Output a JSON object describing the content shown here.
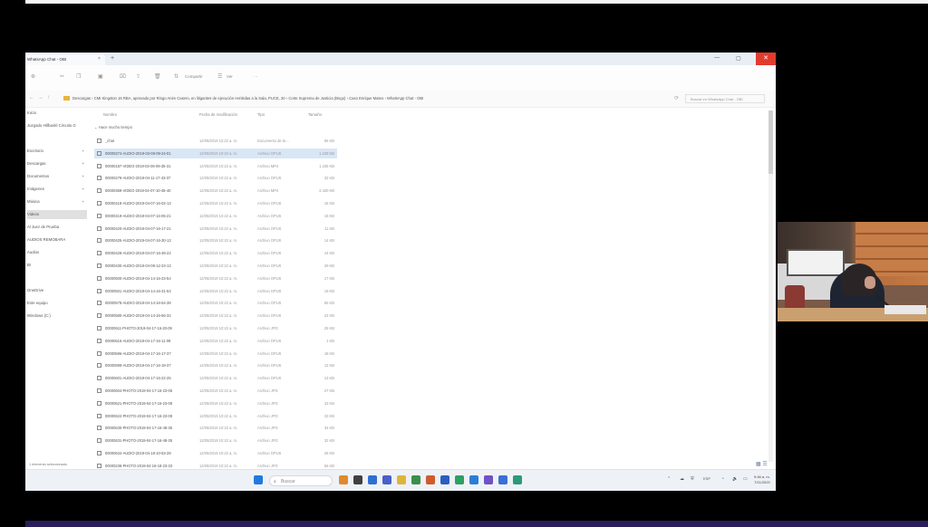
{
  "window": {
    "tab_title": "WhatsApp Chat - OBI",
    "tab_close": "×",
    "new_tab": "+",
    "controls": {
      "minimize": "—",
      "maximize": "▢",
      "close": "✕"
    }
  },
  "commandbar": {
    "share_label": "Compartir",
    "view_label": "Ver",
    "more": "···"
  },
  "address": {
    "back": "←",
    "forward": "→",
    "up": "↑",
    "refresh": "⟳",
    "path": "Descargas › CMI Kingston 16 RBA, aprovado por Ringo Anim Casero, en litigantes de ejecución remitidas a la Sala, PUCE, 20 › Corte Suprema de Justicia (Bogo) › Caso Enrique Mateo › WhatsApp Chat - OBI",
    "search_placeholder": "Buscar en WhatsApp Chat - OBI"
  },
  "sidebar": {
    "items": [
      {
        "label": "Inicio"
      },
      {
        "label": "Juzgado Hillbuskl Circuito G"
      },
      {
        "label": "Escritorio"
      },
      {
        "label": "Descargas"
      },
      {
        "label": "Documentos"
      },
      {
        "label": "Imágenes"
      },
      {
        "label": "Música"
      },
      {
        "label": "Videos"
      },
      {
        "label": "Al Juez de Prueba"
      },
      {
        "label": "AUDIOS REMOBARA"
      },
      {
        "label": "Audios"
      },
      {
        "label": "BI"
      },
      {
        "label": "OneDrive"
      },
      {
        "label": "Este equipo"
      },
      {
        "label": "Windows (C:)"
      }
    ]
  },
  "columns": {
    "name": "Nombre",
    "date": "Fecha de modificación",
    "type": "Tipo",
    "size": "Tamaño"
  },
  "group_label": "Hace mucho tiempo",
  "files": [
    {
      "name": "_chat",
      "date": "12/05/2019 10:22 a. m.",
      "type": "Documento de te...",
      "size": "56 KB"
    },
    {
      "name": "00000274-AUDIO-2019-03-08-09-24-01",
      "date": "12/05/2019 10:22 a. m.",
      "type": "Archivo OPUS",
      "size": "1.238 KB"
    },
    {
      "name": "00000187-VIDEO-2019-03-06-09-35-31",
      "date": "12/05/2019 10:22 a. m.",
      "type": "Archivo MP4",
      "size": "1.235 KB"
    },
    {
      "name": "00000279-AUDIO-2019-04-11-17-43-37",
      "date": "12/05/2019 10:22 a. m.",
      "type": "Archivo OPUS",
      "size": "32 KB"
    },
    {
      "name": "00000369-VIDEO-2019-04-07-10-48-40",
      "date": "12/05/2019 10:22 a. m.",
      "type": "Archivo MP4",
      "size": "2.420 KB"
    },
    {
      "name": "00000418-AUDIO-2019-04-07-16-02-13",
      "date": "12/05/2019 10:22 a. m.",
      "type": "Archivo OPUS",
      "size": "16 KB"
    },
    {
      "name": "00000419-AUDIO-2019-04-07-16-05-21",
      "date": "12/05/2019 10:22 a. m.",
      "type": "Archivo OPUS",
      "size": "15 KB"
    },
    {
      "name": "00000420-AUDIO-2019-04-07-16-17-21",
      "date": "12/05/2019 10:22 a. m.",
      "type": "Archivo OPUS",
      "size": "11 KB"
    },
    {
      "name": "00000425-AUDIO-2019-04-07-16-30-13",
      "date": "12/05/2019 10:22 a. m.",
      "type": "Archivo OPUS",
      "size": "14 KB"
    },
    {
      "name": "00000428-AUDIO-2019-04-07-16-48-22",
      "date": "12/05/2019 10:22 a. m.",
      "type": "Archivo OPUS",
      "size": "44 KB"
    },
    {
      "name": "00000430-AUDIO-2019-04-08-12-23-13",
      "date": "12/05/2019 10:22 a. m.",
      "type": "Archivo OPUS",
      "size": "29 KB"
    },
    {
      "name": "00000500-AUDIO-2019-04-14-16-23-54",
      "date": "12/05/2019 10:22 a. m.",
      "type": "Archivo OPUS",
      "size": "17 KB"
    },
    {
      "name": "00000501-AUDIO-2019-04-14-16-31-53",
      "date": "12/05/2019 10:22 a. m.",
      "type": "Archivo OPUS",
      "size": "19 KB"
    },
    {
      "name": "00000578-AUDIO-2019-04-14-16-54-38",
      "date": "12/05/2019 10:22 a. m.",
      "type": "Archivo OPUS",
      "size": "65 KB"
    },
    {
      "name": "00000580-AUDIO-2019-04-14-16-56-32",
      "date": "12/05/2019 10:22 a. m.",
      "type": "Archivo OPUS",
      "size": "22 KB"
    },
    {
      "name": "00000611-PHOTO-2019-04-17-16-20-09",
      "date": "12/05/2019 10:22 a. m.",
      "type": "Archivo JPG",
      "size": "25 KB"
    },
    {
      "name": "00000616-AUDIO-2019-04-17-16-11-08",
      "date": "12/05/2019 10:22 a. m.",
      "type": "Archivo OPUS",
      "size": "1 KB"
    },
    {
      "name": "00000596-AUDIO-2019-04-17-16-17-37",
      "date": "12/05/2019 10:22 a. m.",
      "type": "Archivo OPUS",
      "size": "18 KB"
    },
    {
      "name": "00000599-AUDIO-2019-04-17-16-18-37",
      "date": "12/05/2019 10:22 a. m.",
      "type": "Archivo OPUS",
      "size": "12 KB"
    },
    {
      "name": "00000601-AUDIO-2019-04-17-16-22-25",
      "date": "12/05/2019 10:22 a. m.",
      "type": "Archivo OPUS",
      "size": "13 KB"
    },
    {
      "name": "00000604-PHOTO-2019-04-17-16-23-05",
      "date": "12/05/2019 10:22 a. m.",
      "type": "Archivo JPG",
      "size": "27 KB"
    },
    {
      "name": "00000621-PHOTO-2019-04-17-16-23-08",
      "date": "12/05/2019 10:22 a. m.",
      "type": "Archivo JPG",
      "size": "33 KB"
    },
    {
      "name": "00000622-PHOTO-2019-04-17-16-23-08",
      "date": "12/05/2019 10:22 a. m.",
      "type": "Archivo JPG",
      "size": "33 KB"
    },
    {
      "name": "00000630-PHOTO-2019-04-17-16-48-35",
      "date": "12/05/2019 10:22 a. m.",
      "type": "Archivo JPG",
      "size": "34 KB"
    },
    {
      "name": "00000631-PHOTO-2019-04-17-16-48-35",
      "date": "12/05/2019 10:22 a. m.",
      "type": "Archivo JPG",
      "size": "32 KB"
    },
    {
      "name": "00000634-AUDIO-2019-04-18-10-53-28",
      "date": "12/05/2019 10:22 a. m.",
      "type": "Archivo OPUS",
      "size": "28 KB"
    },
    {
      "name": "00000238-PHOTO-2019-04-18-18-23-33",
      "date": "12/05/2019 10:22 a. m.",
      "type": "Archivo JPG",
      "size": "56 KB"
    }
  ],
  "statusbar": "1 elemento seleccionado",
  "taskbar": {
    "search_label": "Buscar",
    "search_icon": "⌕",
    "lang": "ESP",
    "clock_time": "9:46 a. m.",
    "clock_date": "7/11/2023"
  },
  "colors": {
    "selection": "#d9e6f6",
    "close_red": "#e23b2e",
    "folder": "#e7b53c"
  }
}
